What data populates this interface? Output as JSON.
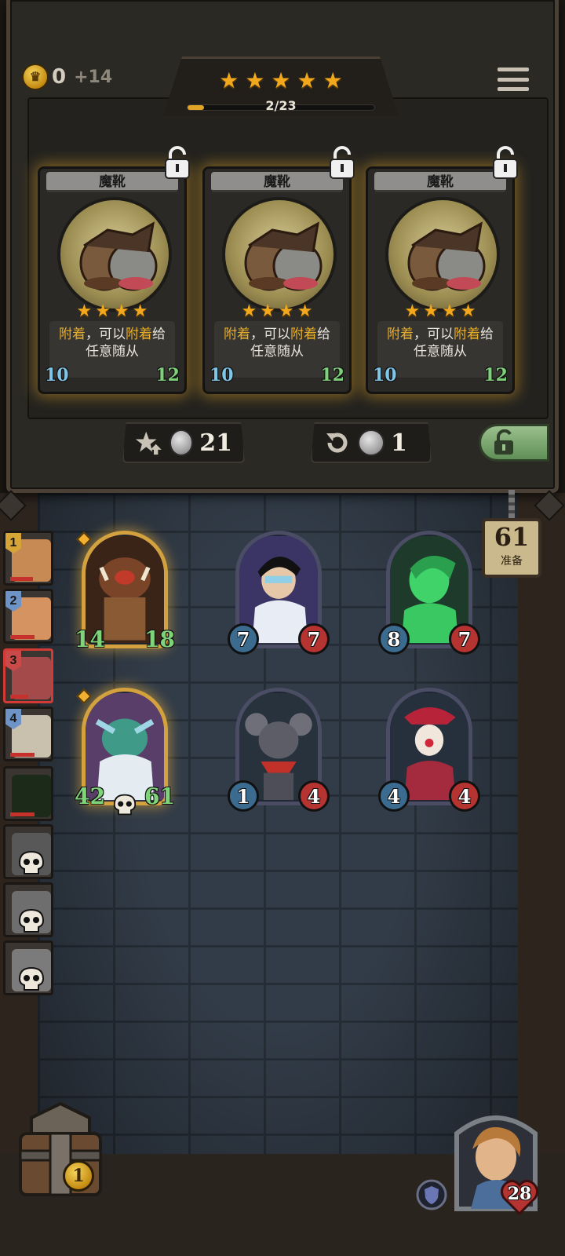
{
  "resources": {
    "gold": "0",
    "gold_income": "+14"
  },
  "tavern": {
    "star_count": 5,
    "xp_text": "2/23",
    "xp_progress": 0.087
  },
  "shop_cards": [
    {
      "name": "魔靴",
      "desc_kw1": "附着",
      "desc_mid": "，可以",
      "desc_kw2": "附着",
      "desc_end": "给",
      "desc_line2": "任意随从",
      "stars": 4,
      "attack": "10",
      "health": "12",
      "locked": false
    },
    {
      "name": "魔靴",
      "desc_kw1": "附着",
      "desc_mid": "，可以",
      "desc_kw2": "附着",
      "desc_end": "给",
      "desc_line2": "任意随从",
      "stars": 4,
      "attack": "10",
      "health": "12",
      "locked": false
    },
    {
      "name": "魔靴",
      "desc_kw1": "附着",
      "desc_mid": "，可以",
      "desc_kw2": "附着",
      "desc_end": "给",
      "desc_line2": "任意随从",
      "stars": 4,
      "attack": "10",
      "health": "12",
      "locked": false
    }
  ],
  "actions": {
    "upgrade_cost": "21",
    "refresh_cost": "1"
  },
  "turn": {
    "number": "61",
    "label": "准备"
  },
  "opponents": [
    {
      "rank": "1",
      "badge": "gold",
      "alive": true,
      "hp_fraction": 0.55
    },
    {
      "rank": "2",
      "badge": "blue",
      "alive": true,
      "hp_fraction": 0.6
    },
    {
      "rank": "3",
      "badge": "red",
      "alive": true,
      "hp_fraction": 0.45,
      "active": true
    },
    {
      "rank": "4",
      "badge": "blue",
      "alive": true,
      "hp_fraction": 0.6
    },
    {
      "rank": "",
      "badge": "none",
      "alive": true,
      "hp_fraction": 0.6
    },
    {
      "rank": "",
      "badge": "none",
      "alive": false
    },
    {
      "rank": "",
      "badge": "none",
      "alive": false
    },
    {
      "rank": "",
      "badge": "none",
      "alive": false
    }
  ],
  "board_minions": [
    {
      "attack": "14",
      "health": "18",
      "golden": true,
      "art": "boar-brute"
    },
    {
      "attack": "7",
      "health": "7",
      "golden": false,
      "art": "masked-mage"
    },
    {
      "attack": "8",
      "health": "7",
      "golden": false,
      "art": "ghost-rogue"
    },
    {
      "attack": "42",
      "health": "61",
      "golden": true,
      "art": "frost-troll",
      "deathrattle": true
    },
    {
      "attack": "1",
      "health": "4",
      "golden": false,
      "art": "rat-bandit"
    },
    {
      "attack": "4",
      "health": "4",
      "golden": false,
      "art": "clown-jester"
    }
  ],
  "hero": {
    "health": "28",
    "chest_count": "1"
  },
  "colors": {
    "gold_star": "#f2a81d",
    "attack_blue": "#3b6c90",
    "health_red": "#b53330",
    "keyword": "#e8ad2a"
  }
}
